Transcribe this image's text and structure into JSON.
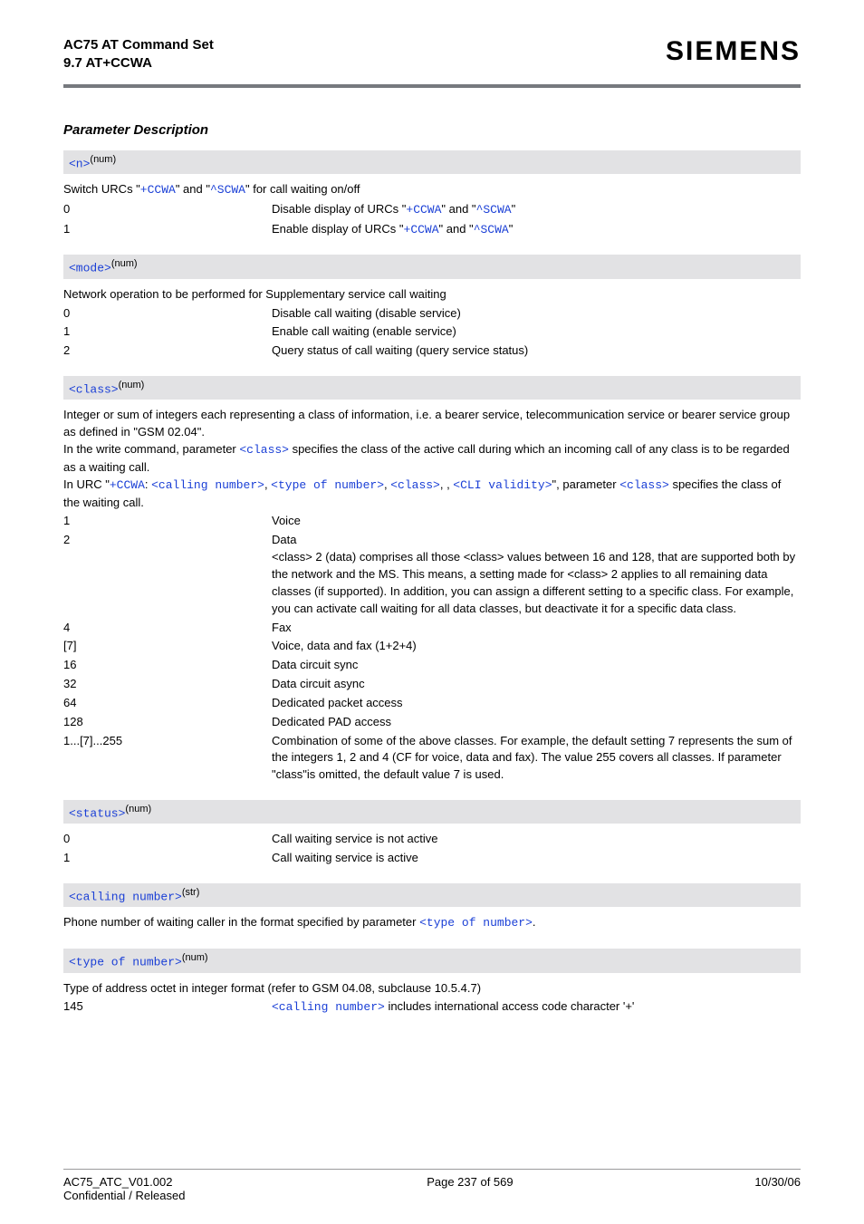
{
  "header": {
    "title_line1": "AC75 AT Command Set",
    "title_line2": "9.7 AT+CCWA",
    "brand": "SIEMENS"
  },
  "section_title": "Parameter Description",
  "n": {
    "label_code": "<n>",
    "label_sup": "(num)",
    "desc_prefix": "Switch URCs \"",
    "desc_c1": "+CCWA",
    "desc_mid1": "\" and \"",
    "desc_c2": "^SCWA",
    "desc_suffix": "\" for call waiting on/off",
    "rows": [
      {
        "k": "0",
        "pre": "Disable display of URCs \"",
        "c1": "+CCWA",
        "mid": "\" and \"",
        "c2": "^SCWA",
        "post": "\""
      },
      {
        "k": "1",
        "pre": "Enable display of URCs \"",
        "c1": "+CCWA",
        "mid": "\" and \"",
        "c2": "^SCWA",
        "post": "\""
      }
    ]
  },
  "mode": {
    "label_code": "<mode>",
    "label_sup": "(num)",
    "desc": "Network operation to be performed for Supplementary service call waiting",
    "rows": [
      {
        "k": "0",
        "v": "Disable call waiting (disable service)"
      },
      {
        "k": "1",
        "v": "Enable call waiting (enable service)"
      },
      {
        "k": "2",
        "v": "Query status of call waiting (query service status)"
      }
    ]
  },
  "class": {
    "label_code": "<class>",
    "label_sup": "(num)",
    "p1a": "Integer or sum of integers each representing a class of information, i.e. a bearer service, telecommunication service or bearer service group as defined in \"GSM 02.04\".",
    "p2a": "In the write command, parameter ",
    "p2_code": "<class>",
    "p2b": " specifies the class of the active call during which an incoming call of any class is to be regarded as a waiting call.",
    "p3a": "In URC \"",
    "p3_c1": "+CCWA",
    "p3_sep1": ": ",
    "p3_c2": "<calling number>",
    "p3_sep2": ", ",
    "p3_c3": "<type of number>",
    "p3_sep3": ", ",
    "p3_c4": "<class>",
    "p3_sep4": ", , ",
    "p3_c5": "<CLI validity>",
    "p3b": "\", parameter ",
    "p3_c6": "<class>",
    "p3c": " specifies the class of the waiting call.",
    "rows": [
      {
        "k": "1",
        "v": "Voice"
      },
      {
        "k": "2",
        "v": "Data",
        "extra": "<class> 2 (data) comprises all those <class> values between 16 and 128, that are supported both by the network and the MS. This means, a setting made for <class> 2 applies to all remaining data classes (if supported). In addition, you can assign a different setting to a specific class. For example, you can activate call waiting for all data classes, but deactivate it for a specific data class."
      },
      {
        "k": "4",
        "v": "Fax"
      },
      {
        "k": "[7]",
        "v": "Voice, data and fax (1+2+4)"
      },
      {
        "k": "16",
        "v": "Data circuit sync"
      },
      {
        "k": "32",
        "v": "Data circuit async"
      },
      {
        "k": "64",
        "v": "Dedicated packet access"
      },
      {
        "k": "128",
        "v": "Dedicated PAD access"
      },
      {
        "k": "1...[7]...255",
        "v": "Combination of some of the above classes. For example, the default setting 7 represents the sum of the integers 1, 2 and 4 (CF for voice, data and fax). The value 255 covers all classes. If parameter \"class\"is omitted, the default value 7 is used."
      }
    ]
  },
  "status": {
    "label_code": "<status>",
    "label_sup": "(num)",
    "rows": [
      {
        "k": "0",
        "v": "Call waiting service is not active"
      },
      {
        "k": "1",
        "v": "Call waiting service is active"
      }
    ]
  },
  "calling_number": {
    "label_code": "<calling number>",
    "label_sup": "(str)",
    "desc_pre": "Phone number of waiting caller in the format specified by parameter ",
    "desc_code": "<type of number>",
    "desc_post": "."
  },
  "type_of_number": {
    "label_code": "<type of number>",
    "label_sup": "(num)",
    "desc": "Type of address octet in integer format (refer to GSM 04.08, subclause 10.5.4.7)",
    "row": {
      "k": "145",
      "v_code": "<calling number>",
      "v_post": " includes international access code character '+'"
    }
  },
  "footer": {
    "left1": "AC75_ATC_V01.002",
    "left2": "Confidential / Released",
    "center": "Page 237 of 569",
    "right": "10/30/06"
  }
}
